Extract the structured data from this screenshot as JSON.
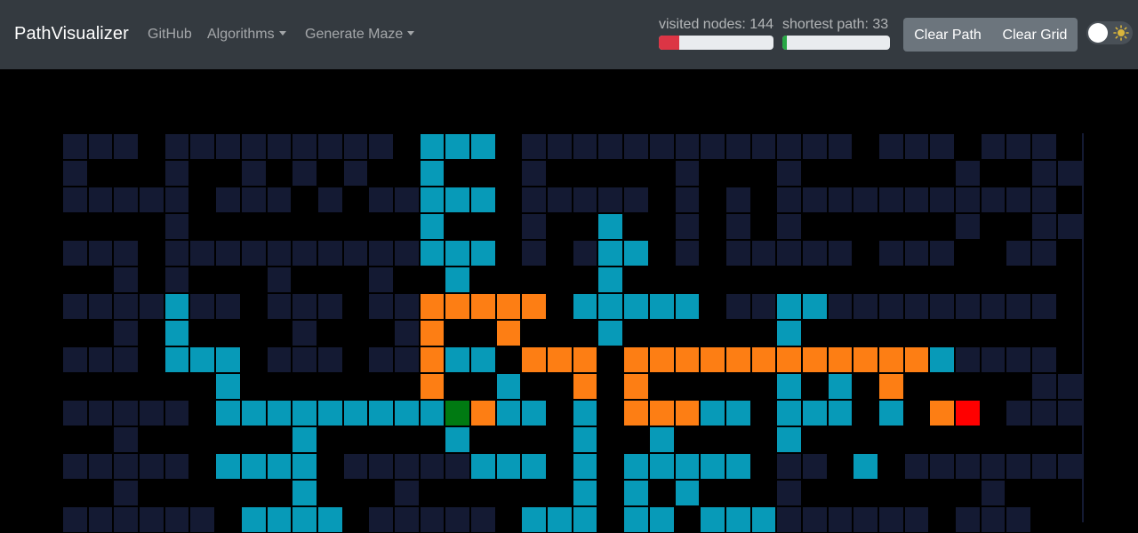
{
  "navbar": {
    "brand": "PathVisualizer",
    "links": {
      "github": "GitHub",
      "algorithms": "Algorithms",
      "generate_maze": "Generate Maze"
    },
    "stats": {
      "visited_label": "visited nodes: 144",
      "visited_fraction": 0.18,
      "visited_color": "#dc3545",
      "shortest_label": "shortest path: 33",
      "shortest_fraction": 0.04,
      "shortest_color": "#28a745"
    },
    "buttons": {
      "clear_path": "Clear Path",
      "clear_grid": "Clear Grid"
    },
    "theme_toggle": {
      "state": "off",
      "icon": "sun-icon"
    }
  },
  "colors": {
    "wall": "#141a33",
    "visited": "#079ab8",
    "path": "#fd7e14",
    "start": "#007a12",
    "end": "#ff0000",
    "background": "#000000"
  },
  "grid": {
    "legend": {
      "W": "wall",
      ".": "empty",
      "V": "visited",
      "P": "path",
      "S": "start",
      "E": "end"
    },
    "rows": [
      "WWW.WWWWWWWWW.VVV.WWWWWWWWWWWWW.WWW.WWW.",
      "W...W..W.W.W..V...W.....W...W......W..WW",
      "WWWWW.WWW.W.WWVVV.WWWWW.W.W.WWWWWWWWWWW.",
      "....W.........V...W..V..W.W.W......W..WW",
      "WWW.WWWWWWWWWWVVV.W.WVV.W.WWWWW.WWW..WW.",
      "..W.W...W...W..V.....V..................",
      "WWWWVWW.WWW.WWPPPPP.VVVVV.WWVVWWWWWWWWW.",
      "..W.V....W...WP..P...V......V...........",
      "WWW.VVV.WWW.WWPVV.PPP.PPPPPPPPPPPPVWWWW.",
      "......V.......P..V..P.P.....V.V.P.....WW",
      "WWWWW.VVVVVVVVVSPVV.V.PPPVV.VVV.V.PE.WWW",
      "..W......V.....V....V..V....V...........",
      "WWWWW.VVVV.WWWWWVVV.V.VVVVV.WW.V.WWWWWWW",
      "..W......V...W......V.V.V...W.......W...",
      "WWWWWW.VVVV.WWWWW.VVV.VV.VVVWWWWWW.WWW.."
    ]
  }
}
